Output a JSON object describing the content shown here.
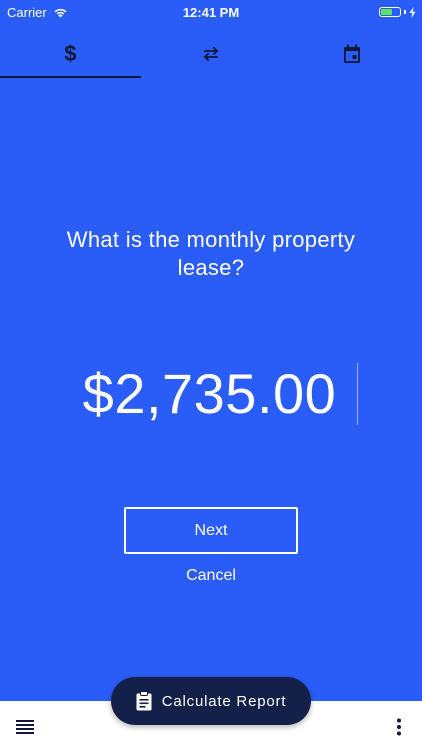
{
  "status_bar": {
    "carrier": "Carrier",
    "time": "12:41 PM",
    "battery_level": 0.6,
    "battery_color": "#5ee35c"
  },
  "tabs": [
    {
      "icon": "dollar-icon",
      "glyph": "$",
      "active": true
    },
    {
      "icon": "swap-arrows-icon",
      "active": false
    },
    {
      "icon": "calendar-icon",
      "active": false
    }
  ],
  "question": {
    "text": "What is the monthly property lease?"
  },
  "amount": {
    "value": "$2,735.00"
  },
  "actions": {
    "next_label": "Next",
    "cancel_label": "Cancel"
  },
  "fab": {
    "label": "Calculate Report",
    "icon": "clipboard-icon"
  },
  "bottom_bar": {
    "left_icon": "menu-icon",
    "right_icon": "more-vertical-icon"
  },
  "colors": {
    "background": "#2a5cf7",
    "fab": "#132047",
    "tab_active": "#10183a"
  }
}
